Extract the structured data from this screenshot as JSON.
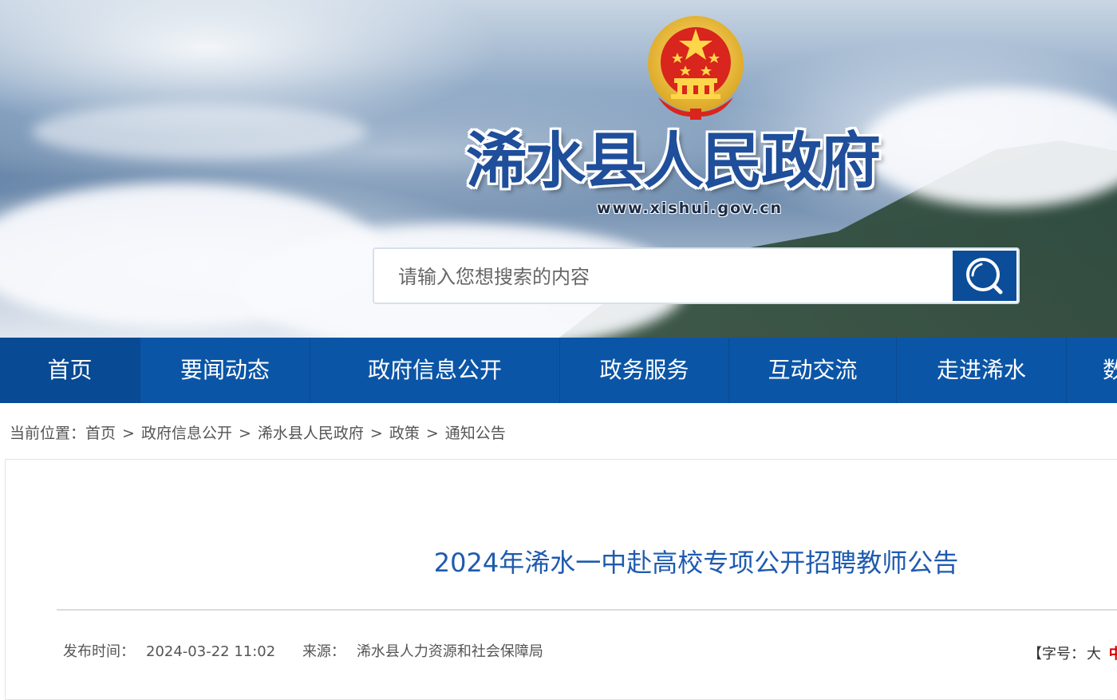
{
  "header": {
    "site_title": "浠水县人民政府",
    "site_url": "www.xishui.gov.cn",
    "emblem_icon": "national-emblem-icon"
  },
  "search": {
    "placeholder": "请输入您想搜索的内容",
    "button_icon": "search-icon"
  },
  "nav": {
    "items": [
      {
        "label": "首页"
      },
      {
        "label": "要闻动态"
      },
      {
        "label": "政府信息公开"
      },
      {
        "label": "政务服务"
      },
      {
        "label": "互动交流"
      },
      {
        "label": "走进浠水"
      },
      {
        "label": "数"
      }
    ]
  },
  "breadcrumb": {
    "prefix": "当前位置：",
    "separator": ">",
    "items": [
      "首页",
      "政府信息公开",
      "浠水县人民政府",
      "政策",
      "通知公告"
    ]
  },
  "article": {
    "title": "2024年浠水一中赴高校专项公开招聘教师公告",
    "publish_time_label": "发布时间：",
    "publish_time": "2024-03-22 11:02",
    "source_label": "来源：",
    "source": "浠水县人力资源和社会保障局",
    "font_size_prefix": "【字号：",
    "font_size_large": "大",
    "font_size_medium": "中"
  },
  "colors": {
    "nav_bg": "#0b55a6",
    "title_blue": "#1e5bb0",
    "accent_red": "#d40000",
    "search_button": "#0b4d99"
  }
}
